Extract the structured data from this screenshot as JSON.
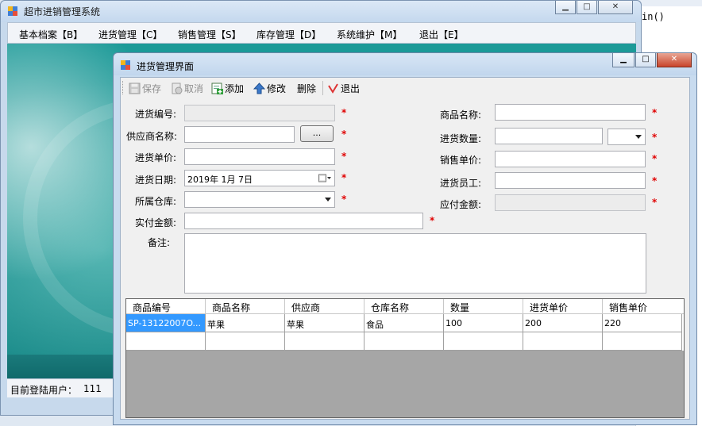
{
  "main_window": {
    "title": "超市进销管理系统",
    "menu": [
      "基本档案【B】",
      "进货管理【C】",
      "销售管理【S】",
      "库存管理【D】",
      "系统维护【M】",
      "退出【E】"
    ],
    "status_text": "目前登陆用户：",
    "status_user": "111"
  },
  "background_text": "in()",
  "dialog": {
    "title": "进货管理界面",
    "toolbar": {
      "save": "保存",
      "cancel": "取消",
      "add": "添加",
      "edit": "修改",
      "delete": "删除",
      "exit": "退出"
    },
    "form": {
      "purchase_no_label": "进货编号:",
      "purchase_no_value": "",
      "supplier_label": "供应商名称:",
      "supplier_value": "",
      "browse_label": "...",
      "unit_price_label": "进货单价:",
      "unit_price_value": "",
      "date_label": "进货日期:",
      "date_value": "2019年  1月  7日",
      "warehouse_label": "所属仓库:",
      "warehouse_value": "",
      "paid_label": "实付金额:",
      "paid_value": "",
      "remark_label": "备注:",
      "remark_value": "",
      "product_label": "商品名称:",
      "product_value": "",
      "quantity_label": "进货数量:",
      "quantity_value": "",
      "unit_value": "",
      "sale_price_label": "销售单价:",
      "sale_price_value": "",
      "staff_label": "进货员工:",
      "staff_value": "",
      "payable_label": "应付金额:",
      "payable_value": "",
      "required_mark": "*"
    },
    "grid": {
      "columns": [
        "商品编号",
        "商品名称",
        "供应商",
        "仓库名称",
        "数量",
        "进货单价",
        "销售单价"
      ],
      "rows": [
        [
          "SP-13122007O...",
          "苹果",
          "苹果",
          "食品",
          "100",
          "200",
          "220"
        ],
        [
          "",
          "",
          "",
          "",
          "",
          "",
          ""
        ]
      ]
    }
  },
  "colors": {
    "accent": "#3399ff",
    "required": "#e00000",
    "client_bg": "#0f8c8a"
  }
}
